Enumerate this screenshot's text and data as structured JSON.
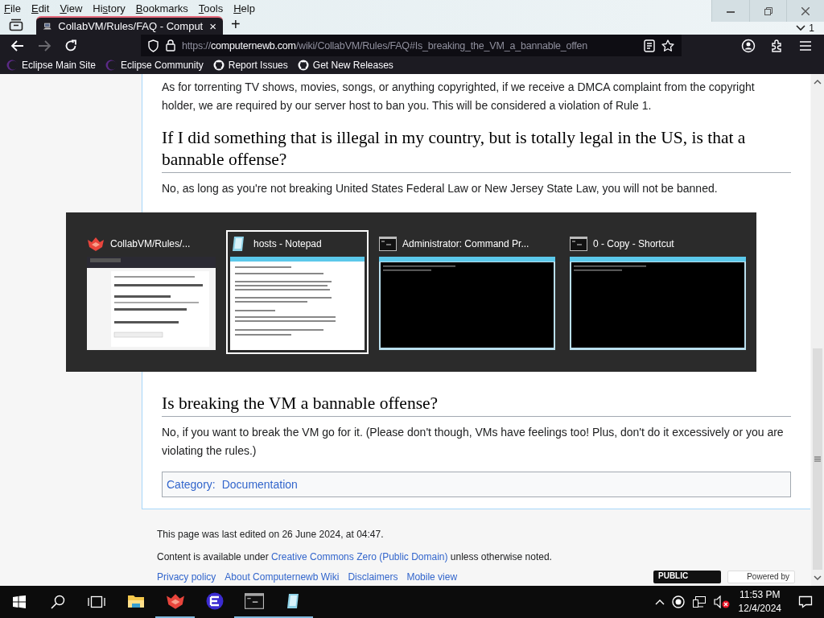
{
  "menu": [
    {
      "key": "F",
      "after": "ile"
    },
    {
      "key": "E",
      "after": "dit"
    },
    {
      "key": "V",
      "after": "iew"
    },
    {
      "before": "Hi",
      "key": "s",
      "after": "tory"
    },
    {
      "key": "B",
      "after": "ookmarks"
    },
    {
      "key": "T",
      "after": "ools"
    },
    {
      "key": "H",
      "after": "elp"
    }
  ],
  "window_controls": {
    "badge": "1"
  },
  "tabs": [
    {
      "title": "CollabVM/Rules/FAQ - Comput",
      "selected": true,
      "close": "×"
    }
  ],
  "new_tab": "+",
  "nav": {
    "forward_disabled": true,
    "url_parts": [
      "https://",
      "computernewb.com",
      "/wiki/CollabVM/Rules/FAQ#Is_breaking_the_VM_a_bannable_offen"
    ]
  },
  "bookmarks": [
    {
      "kind": "eclipse",
      "label": "Eclipse Main Site"
    },
    {
      "kind": "eclipse",
      "label": "Eclipse Community"
    },
    {
      "kind": "github",
      "label": "Report Issues"
    },
    {
      "kind": "github",
      "label": "Get New Releases"
    }
  ],
  "article": {
    "blocks": [
      {
        "kind": "p",
        "text": "As for torrenting TV shows, movies, songs, or anything copyrighted, if we receive a DMCA complaint from the copyright holder, we are required by our server host to ban you. This will be considered a violation of Rule 1."
      },
      {
        "kind": "h2",
        "text": "If I did something that is illegal in my country, but is totally legal in the US, is that a bannable offense?"
      },
      {
        "kind": "p",
        "text": "No, as long as you're not breaking United States Federal Law or New Jersey State Law, you will not be banned."
      },
      {
        "kind": "hidden"
      },
      {
        "kind": "h2",
        "text": "Is breaking the VM a bannable offense?"
      },
      {
        "kind": "p",
        "text": "No, if you want to break the VM go for it. (Please don't though, VMs have feelings too! Plus, don't do it excessively or you are violating the rules.)"
      }
    ],
    "category": {
      "label": "Category:",
      "link": "Documentation"
    }
  },
  "footer": {
    "edited": "This page was last edited on 26 June 2024, at 04:47.",
    "license": {
      "before": "Content is available under ",
      "link": "Creative Commons Zero (Public Domain)",
      "after": " unless otherwise noted."
    },
    "links": [
      "Privacy policy",
      "About Computernewb Wiki",
      "Disclaimers",
      "Mobile view"
    ],
    "badges": [
      {
        "kind": "public-domain",
        "label": "PUBLIC"
      },
      {
        "kind": "mediawiki",
        "label": "Powered by"
      }
    ]
  },
  "alt_tab": [
    {
      "kind": "browser",
      "title": "CollabVM/Rules/...",
      "selected": false
    },
    {
      "kind": "notepad",
      "title": "hosts - Notepad",
      "selected": true
    },
    {
      "kind": "console",
      "title": "Administrator: Command Pr...",
      "selected": false
    },
    {
      "kind": "console",
      "title": "0 - Copy - Shortcut",
      "selected": false
    }
  ],
  "taskbar": {
    "apps": [
      {
        "kind": "explorer",
        "running": false
      },
      {
        "kind": "collabvm",
        "running": true
      },
      {
        "kind": "eclipse",
        "running": false
      },
      {
        "kind": "console",
        "running": true
      },
      {
        "kind": "notepad",
        "running": true
      }
    ],
    "time": "11:53 PM",
    "date": "12/4/2024",
    "volume_muted": true
  }
}
